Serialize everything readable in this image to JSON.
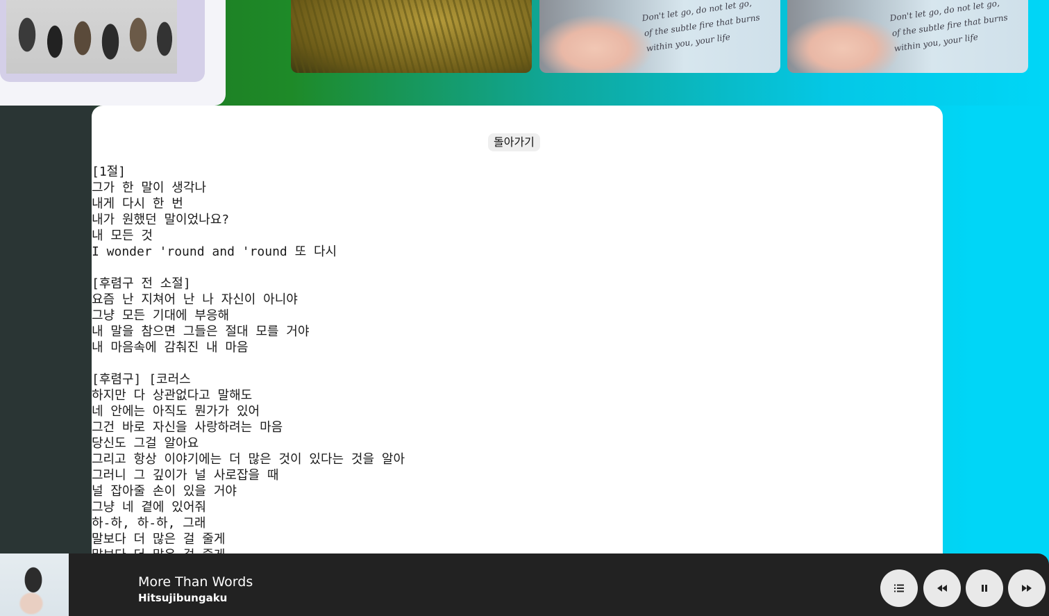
{
  "header": {
    "album_thumbs": [
      {
        "name": "group-photo"
      },
      {
        "name": "grass-field"
      },
      {
        "name": "hand-lyrics-card-1",
        "text": "Don't let go, do not let go,\nof the subtle fire that burns\nwithin you, your life"
      },
      {
        "name": "hand-lyrics-card-2",
        "text": "Don't let go, do not let go,\nof the subtle fire that burns\nwithin you, your life"
      }
    ]
  },
  "lyrics_panel": {
    "back_label": "돌아가기",
    "text": "[1절]\n그가 한 말이 생각나\n내게 다시 한 번\n내가 원했던 말이었나요?\n내 모든 것\nI wonder 'round and 'round 또 다시\n\n[후렴구 전 소절]\n요즘 난 지쳐어 난 나 자신이 아니야\n그냥 모든 기대에 부응해\n내 말을 참으면 그들은 절대 모를 거야\n내 마음속에 감춰진 내 마음\n\n[후렴구] [코러스\n하지만 다 상관없다고 말해도\n네 안에는 아직도 뭔가가 있어\n그건 바로 자신을 사랑하려는 마음\n당신도 그걸 알아요\n그리고 항상 이야기에는 더 많은 것이 있다는 것을 알아\n그러니 그 깊이가 널 사로잡을 때\n널 잡아줄 손이 있을 거야\n그냥 네 곁에 있어줘\n하-하, 하-하, 그래\n말보다 더 많은 걸 줄게\n말보다 더 많은 걸 줄게"
  },
  "player": {
    "title": "More Than Words",
    "artist": "Hitsujibungaku",
    "controls": [
      "queue-icon",
      "previous-icon",
      "pause-icon",
      "next-icon"
    ]
  }
}
